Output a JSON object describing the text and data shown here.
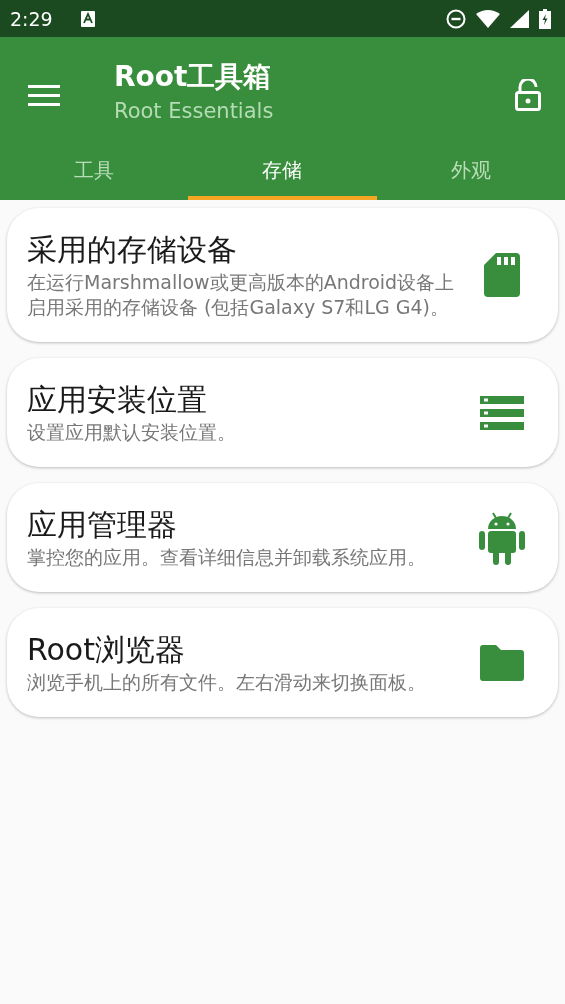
{
  "status_bar": {
    "time": "2:29"
  },
  "app_bar": {
    "title": "Root工具箱",
    "subtitle": "Root Essentials"
  },
  "tabs": [
    {
      "label": "工具",
      "selected": false
    },
    {
      "label": "存储",
      "selected": true
    },
    {
      "label": "外观",
      "selected": false
    }
  ],
  "cards": [
    {
      "kind": "sd-card",
      "title": "采用的存储设备",
      "description": "在运行Marshmallow或更高版本的Android设备上启用采用的存储设备 (包括Galaxy S7和LG G4)。"
    },
    {
      "kind": "storage",
      "title": "应用安装位置",
      "description": "设置应用默认安装位置。"
    },
    {
      "kind": "android",
      "title": "应用管理器",
      "description": "掌控您的应用。查看详细信息并卸载系统应用。"
    },
    {
      "kind": "folder",
      "title": "Root浏览器",
      "description": "浏览手机上的所有文件。左右滑动来切换面板。"
    }
  ]
}
